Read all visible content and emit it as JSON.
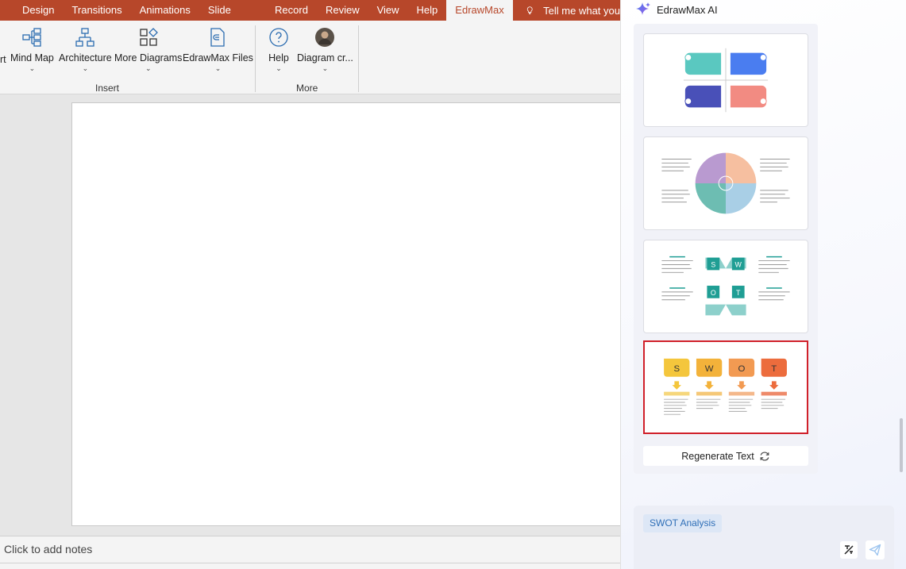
{
  "menubar": {
    "tabs": [
      "Design",
      "Transitions",
      "Animations",
      "Slide Show",
      "Record",
      "Review",
      "View",
      "Help"
    ],
    "active_tab": "EdrawMax",
    "tell_me": "Tell me what you"
  },
  "ribbon": {
    "insert": {
      "partial_label": "rt",
      "mind_map": "Mind Map",
      "architecture": "Architecture",
      "more_diagrams": "More Diagrams",
      "edrawmax_files": "EdrawMax Files",
      "group_label": "Insert"
    },
    "more": {
      "help": "Help",
      "diagram_creator": "Diagram cr...",
      "group_label": "More"
    },
    "chevron": "⌄"
  },
  "notes": {
    "placeholder": "Click to add notes"
  },
  "ai_panel": {
    "title": "EdrawMax AI",
    "regenerate_label": "Regenerate Text",
    "input_chip": "SWOT Analysis",
    "swot_letters": [
      "S",
      "W",
      "O",
      "T"
    ],
    "colors": {
      "accent": "#b7472a",
      "selected_border": "#d0202a",
      "chip_text": "#2f6fb7",
      "send": "#9cc4ef"
    }
  }
}
